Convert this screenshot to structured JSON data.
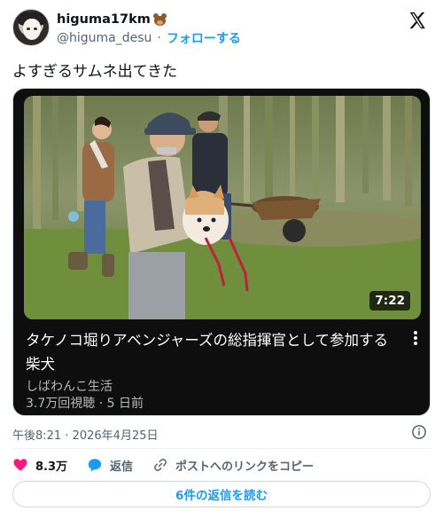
{
  "user": {
    "display_name": "higuma17km",
    "handle": "@higuma_desu",
    "follow_label": "フォローする",
    "emoji_icon": "bear-face-icon"
  },
  "tweet": {
    "text": "よすぎるサムネ出てきた",
    "timestamp": "午後8:21 · 2026年4月25日"
  },
  "video": {
    "duration": "7:22",
    "title": "タケノコ堀りアベンジャーズの総指揮官として参加する柴犬",
    "channel": "しばわんこ生活",
    "meta": "3.7万回視聴 · 5 日前"
  },
  "actions": {
    "like_count": "8.3万",
    "reply_label": "返信",
    "share_label": "ポストへのリンクをコピー"
  },
  "footer": {
    "read_replies_label": "6件の返信を読む"
  },
  "colors": {
    "accent": "#1d9bf0",
    "like": "#f91880",
    "text": "#0f1419",
    "muted": "#536471"
  }
}
